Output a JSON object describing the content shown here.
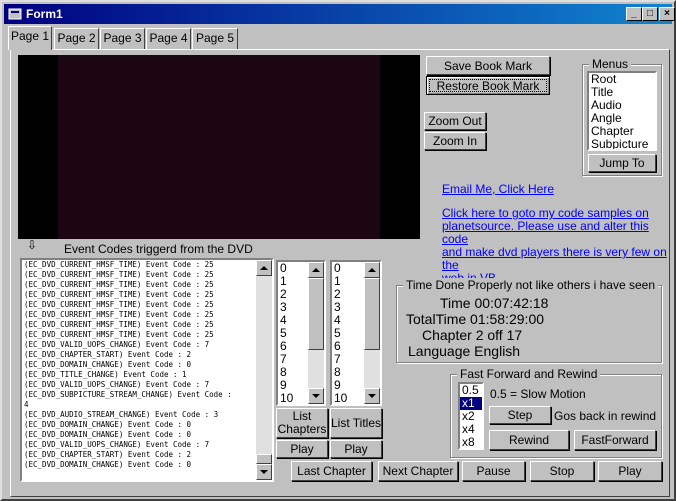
{
  "window": {
    "title": "Form1",
    "minimize": "_",
    "maximize": "□",
    "close": "×"
  },
  "tabs": [
    "Page 1",
    "Page 2",
    "Page 3",
    "Page 4",
    "Page 5"
  ],
  "bookmark": {
    "save": "Save Book Mark",
    "restore": "Restore Book Mark"
  },
  "zoom": {
    "out": "Zoom Out",
    "in": "Zoom In"
  },
  "menus": {
    "label": "Menus",
    "items": [
      "Root",
      "Title",
      "Audio",
      "Angle",
      "Chapter",
      "Subpicture"
    ],
    "jump": "Jump To"
  },
  "links": {
    "email": "Email Me, Click Here",
    "samples": [
      "Click here to goto my code samples on",
      "planetsource. Please use and alter this code",
      "and make dvd players there is very few on the",
      "web in VB"
    ]
  },
  "events": {
    "marker": "⇩",
    "label": "Event Codes triggerd from the DVD",
    "lines": [
      "(EC_DVD_CURRENT_HMSF_TIME) Event Code : 25",
      "(EC_DVD_CURRENT_HMSF_TIME) Event Code : 25",
      "(EC_DVD_CURRENT_HMSF_TIME) Event Code : 25",
      "(EC_DVD_CURRENT_HMSF_TIME) Event Code : 25",
      "(EC_DVD_CURRENT_HMSF_TIME) Event Code : 25",
      "(EC_DVD_CURRENT_HMSF_TIME) Event Code : 25",
      "(EC_DVD_CURRENT_HMSF_TIME) Event Code : 25",
      "(EC_DVD_CURRENT_HMSF_TIME) Event Code : 25",
      "(EC_DVD_VALID_UOPS_CHANGE) Event Code : 7",
      "(EC_DVD_CHAPTER_START) Event Code : 2",
      "(EC_DVD_DOMAIN_CHANGE) Event Code : 0",
      "(EC_DVD_TITLE_CHANGE) Event Code : 1",
      "(EC_DVD_VALID_UOPS_CHANGE) Event Code : 7",
      "(EC_DVD_SUBPICTURE_STREAM_CHANGE) Event Code :",
      "4",
      "(EC_DVD_AUDIO_STREAM_CHANGE) Event Code : 3",
      "(EC_DVD_DOMAIN_CHANGE) Event Code : 0",
      "(EC_DVD_DOMAIN_CHANGE) Event Code : 0",
      "(EC_DVD_VALID_UOPS_CHANGE) Event Code : 7",
      "(EC_DVD_CHAPTER_START) Event Code : 2",
      "(EC_DVD_DOMAIN_CHANGE) Event Code : 0"
    ]
  },
  "chapters": {
    "items": [
      "0",
      "1",
      "2",
      "3",
      "4",
      "5",
      "6",
      "7",
      "8",
      "9",
      "10"
    ],
    "list_btn": "List Chapters",
    "play": "Play"
  },
  "titles": {
    "items": [
      "0",
      "1",
      "2",
      "3",
      "4",
      "5",
      "6",
      "7",
      "8",
      "9",
      "10"
    ],
    "list_btn": "List Titles",
    "play": "Play"
  },
  "time": {
    "label": "Time Done Properly not like others i have seen",
    "time": "Time 00:07:42:18",
    "total": "TotalTime 01:58:29:00",
    "chapter": "Chapter 2 off 17",
    "language": "Language English"
  },
  "ff": {
    "label": "Fast Forward and Rewind",
    "speeds": [
      "0.5",
      "x1",
      "x2",
      "x4",
      "x8"
    ],
    "selected_index": 1,
    "hint": "0.5 = Slow Motion",
    "step": "Step",
    "step_hint": "Gos back in rewind",
    "rewind": "Rewind",
    "fastforward": "FastForward"
  },
  "transport": {
    "last": "Last Chapter",
    "next": "Next Chapter",
    "pause": "Pause",
    "stop": "Stop",
    "play": "Play"
  },
  "colors": {
    "titlebar": "#000080",
    "video": "#1b0612",
    "link": "#0000ff",
    "face": "#c0c0c0"
  }
}
